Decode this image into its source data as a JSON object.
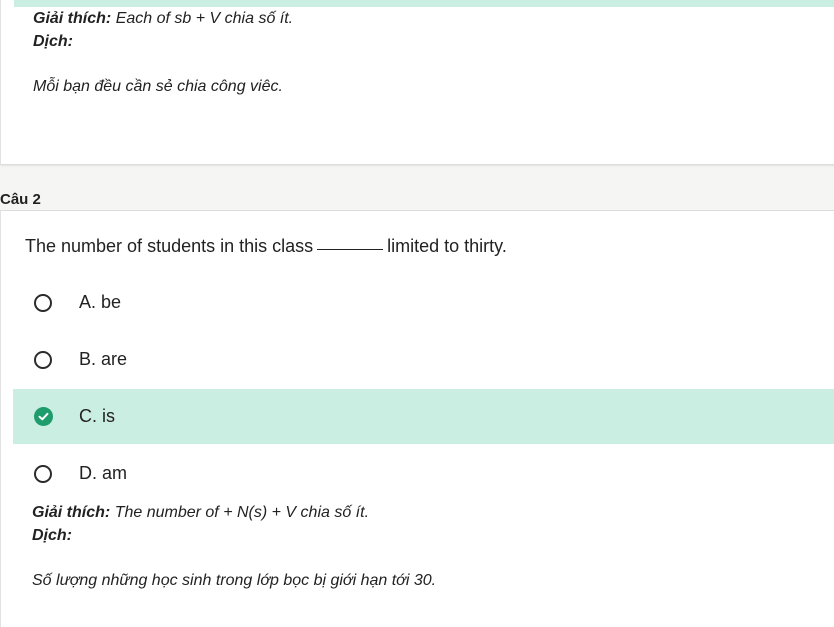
{
  "colors": {
    "accent": "#1e9c6b",
    "highlight": "#cbeee3"
  },
  "question1": {
    "explanation_label": "Giải thích:",
    "explanation_text": "Each of sb + V chia số ít.",
    "translation_label": "Dịch:",
    "translation_text": "Mỗi bạn đều cần sẻ chia công viêc."
  },
  "question2": {
    "header": "Câu 2",
    "text_before": "The number of students in this class",
    "text_after": "limited to thirty.",
    "options": [
      {
        "label": "A. be",
        "selected": false
      },
      {
        "label": "B. are",
        "selected": false
      },
      {
        "label": "C. is",
        "selected": true
      },
      {
        "label": "D. am",
        "selected": false
      }
    ],
    "explanation_label": "Giải thích:",
    "explanation_text": "The number of + N(s) + V chia số ít.",
    "translation_label": "Dịch:",
    "translation_text": "Số lượng những học sinh trong lớp bọc bị giới hạn tới 30."
  }
}
